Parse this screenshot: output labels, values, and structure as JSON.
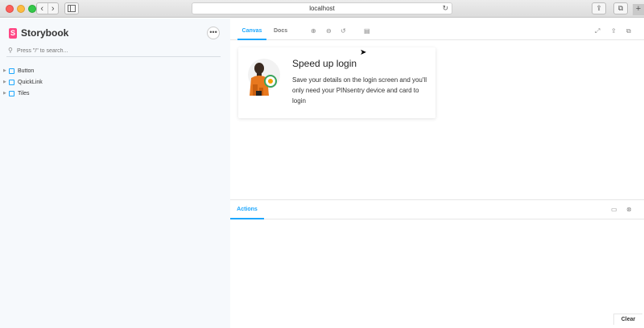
{
  "browser": {
    "url": "localhost",
    "back_icon": "chevron-left",
    "forward_icon": "chevron-right",
    "reload_icon": "↻",
    "share_icon": "⇪",
    "tabs_icon": "⧉",
    "newtab_icon": "+"
  },
  "sidebar": {
    "brand": "Storybook",
    "menu_icon": "•••",
    "search_placeholder": "Press \"/\" to search...",
    "items": [
      {
        "label": "Button"
      },
      {
        "label": "QuickLink"
      },
      {
        "label": "Tiles"
      }
    ]
  },
  "toolbar": {
    "tabs": [
      {
        "label": "Canvas",
        "active": true
      },
      {
        "label": "Docs",
        "active": false
      }
    ],
    "icons": [
      "zoom-in-icon",
      "zoom-out-icon",
      "zoom-reset-icon",
      "background-icon",
      "fullscreen-icon",
      "share-icon",
      "copy-icon"
    ]
  },
  "card": {
    "title": "Speed up login",
    "body": "Save your details on the login screen and you'll only need your PINsentry device and card to login"
  },
  "addons": {
    "tab_label": "Actions",
    "clear_label": "Clear"
  },
  "colors": {
    "accent": "#1ea7fd",
    "brand": "#ff4785",
    "sidebar_bg": "#f6f9fc"
  }
}
